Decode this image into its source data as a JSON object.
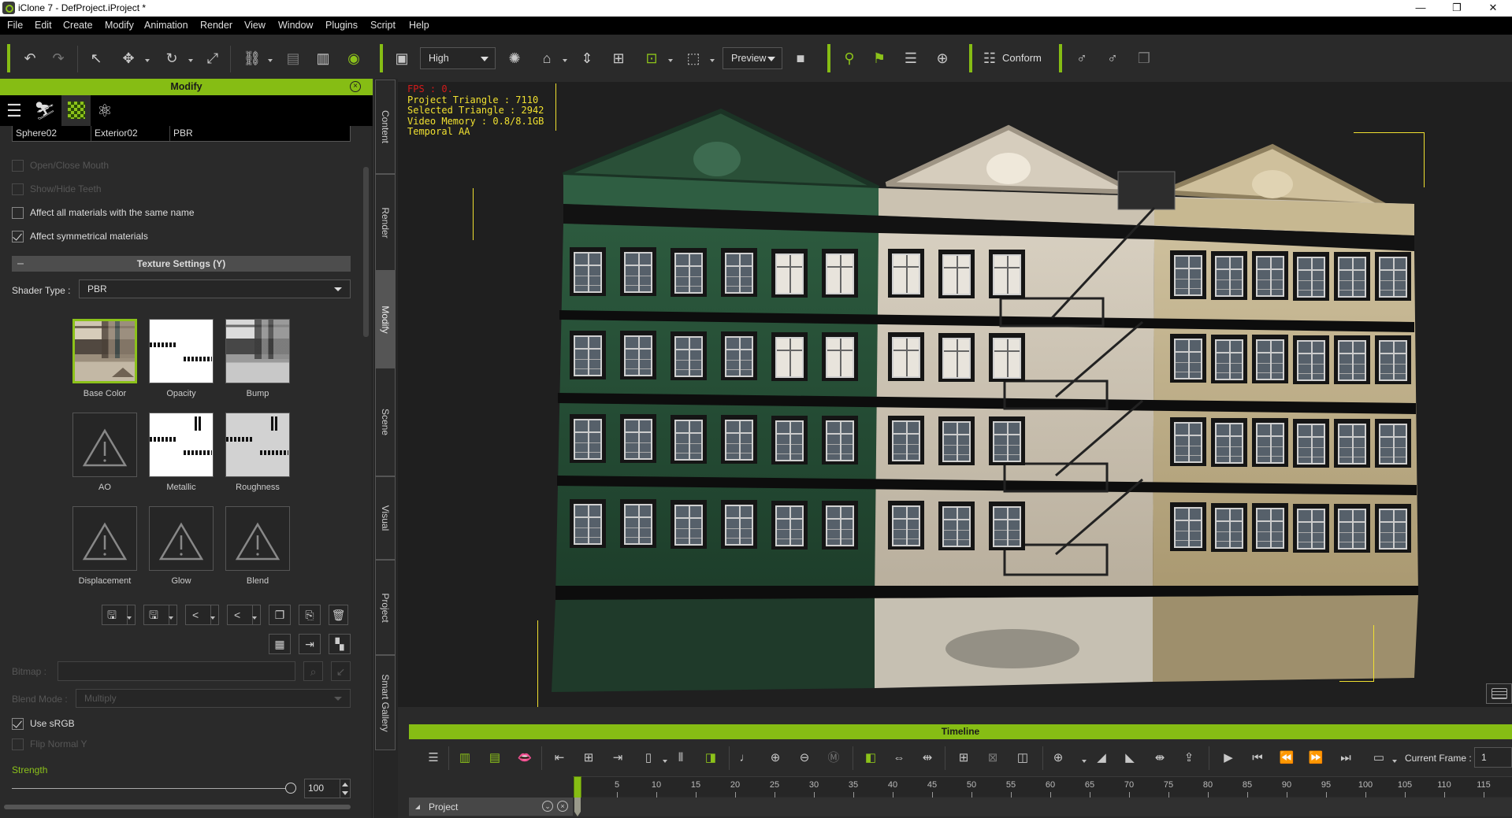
{
  "window": {
    "title": "iClone 7 - DefProject.iProject *",
    "controls": {
      "minimize": "—",
      "restore": "❐",
      "close": "✕"
    }
  },
  "menu": [
    "File",
    "Edit",
    "Create",
    "Modify",
    "Animation",
    "Render",
    "View",
    "Window",
    "Plugins",
    "Script",
    "Help"
  ],
  "toolbar": {
    "quality_select": "High",
    "render_mode_select": "Preview",
    "conform_label": "Conform",
    "icons": [
      "undo-icon",
      "redo-icon",
      "select-icon",
      "move-icon",
      "rotate-icon",
      "scale-icon",
      "link-icon",
      "align-icon",
      "align-right-icon",
      "visibility-eye-icon",
      "view-layout-icon",
      "light-icon",
      "home-camera-icon",
      "fit-vertical-icon",
      "fit-all-icon",
      "gizmo-icon",
      "bounding-box-icon",
      "camera-icon",
      "motion-key-icon",
      "flag-icon",
      "checklist-icon",
      "pin-icon",
      "conform-icon",
      "character-icon",
      "character-view-icon",
      "cubes-icon"
    ]
  },
  "left_panel": {
    "header": "Modify",
    "tab_icons": [
      "sliders-icon",
      "motion-icon",
      "material-checker-icon",
      "atom-icon"
    ],
    "material_row": [
      "Sphere02",
      "Exterior02",
      "PBR"
    ],
    "checkboxes": [
      {
        "label": "Open/Close Mouth",
        "checked": false,
        "enabled": false
      },
      {
        "label": "Show/Hide Teeth",
        "checked": false,
        "enabled": false
      },
      {
        "label": "Affect all materials with the same name",
        "checked": false,
        "enabled": true
      },
      {
        "label": "Affect symmetrical materials",
        "checked": true,
        "enabled": true
      }
    ],
    "texture_settings_title": "Texture Settings  (Y)",
    "shader_type_label": "Shader Type :",
    "shader_type_value": "PBR",
    "textures": [
      {
        "label": "Base Color",
        "state": "image",
        "selected": true
      },
      {
        "label": "Opacity",
        "state": "image",
        "selected": false
      },
      {
        "label": "Bump",
        "state": "image",
        "selected": false
      },
      {
        "label": "AO",
        "state": "missing",
        "selected": false
      },
      {
        "label": "Metallic",
        "state": "image",
        "selected": false
      },
      {
        "label": "Roughness",
        "state": "image",
        "selected": false
      },
      {
        "label": "Displacement",
        "state": "missing",
        "selected": false
      },
      {
        "label": "Glow",
        "state": "missing",
        "selected": false
      },
      {
        "label": "Blend",
        "state": "missing",
        "selected": false
      }
    ],
    "bitmap_label": "Bitmap :",
    "bitmap_value": "",
    "blend_mode_label": "Blend Mode :",
    "blend_mode_value": "Multiply",
    "use_srgb": {
      "label": "Use sRGB",
      "checked": true,
      "enabled": true
    },
    "flip_normal_y": {
      "label": "Flip Normal Y",
      "checked": false,
      "enabled": false
    },
    "strength_label": "Strength",
    "strength_value": "100",
    "strength_fraction": 1.0
  },
  "vertical_tabs": [
    {
      "label": "Content",
      "active": false
    },
    {
      "label": "Render",
      "active": false
    },
    {
      "label": "Modify",
      "active": true
    },
    {
      "label": "Scene",
      "active": false
    },
    {
      "label": "Visual",
      "active": false
    },
    {
      "label": "Project",
      "active": false
    },
    {
      "label": "Smart Gallery",
      "active": false
    }
  ],
  "viewport": {
    "stats": {
      "fps": "FPS : 0.",
      "project_triangle": "Project Triangle : 7110",
      "selected_triangle": "Selected Triangle : 2942",
      "video_memory": "Video Memory : 0.8/8.1GB",
      "aa": "Temporal AA"
    }
  },
  "timeline": {
    "title": "Timeline",
    "current_frame_label": "Current Frame :",
    "current_frame_value": "1",
    "ruler_ticks": [
      "5",
      "10",
      "15",
      "20",
      "25",
      "30",
      "35",
      "40",
      "45",
      "50",
      "55",
      "60",
      "65",
      "70",
      "75",
      "80",
      "85",
      "90",
      "95",
      "100",
      "105",
      "110",
      "115"
    ],
    "track_label": "Project"
  },
  "colors": {
    "accent": "#86bd14",
    "panel_bg": "#2a2a2a",
    "viewport_bg": "#1f1f1f",
    "stats_text": "#f0e030",
    "fps_text": "#d41a1a"
  }
}
